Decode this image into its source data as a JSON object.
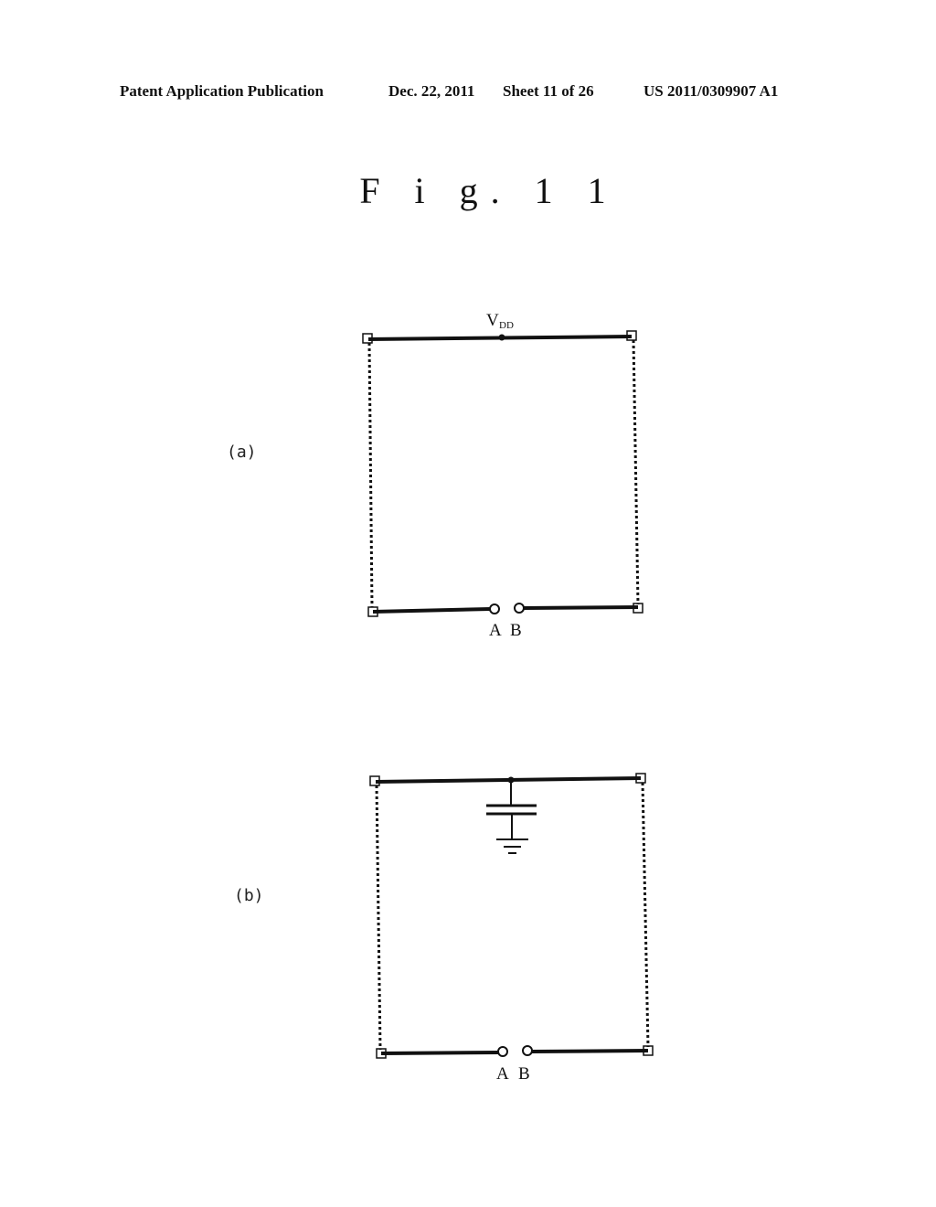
{
  "header": {
    "publication": "Patent Application Publication",
    "date": "Dec. 22, 2011",
    "sheet": "Sheet 11 of 26",
    "number": "US 2011/0309907 A1"
  },
  "figure": {
    "title": "F i g. 1 1"
  },
  "diagrams": [
    {
      "label": "(a)",
      "top_node_label": "V",
      "top_node_subscript": "DD",
      "terminal_a": "A",
      "terminal_b": "B"
    },
    {
      "label": "(b)",
      "top_element": "capacitor-to-ground",
      "terminal_a": "A",
      "terminal_b": "B"
    }
  ]
}
